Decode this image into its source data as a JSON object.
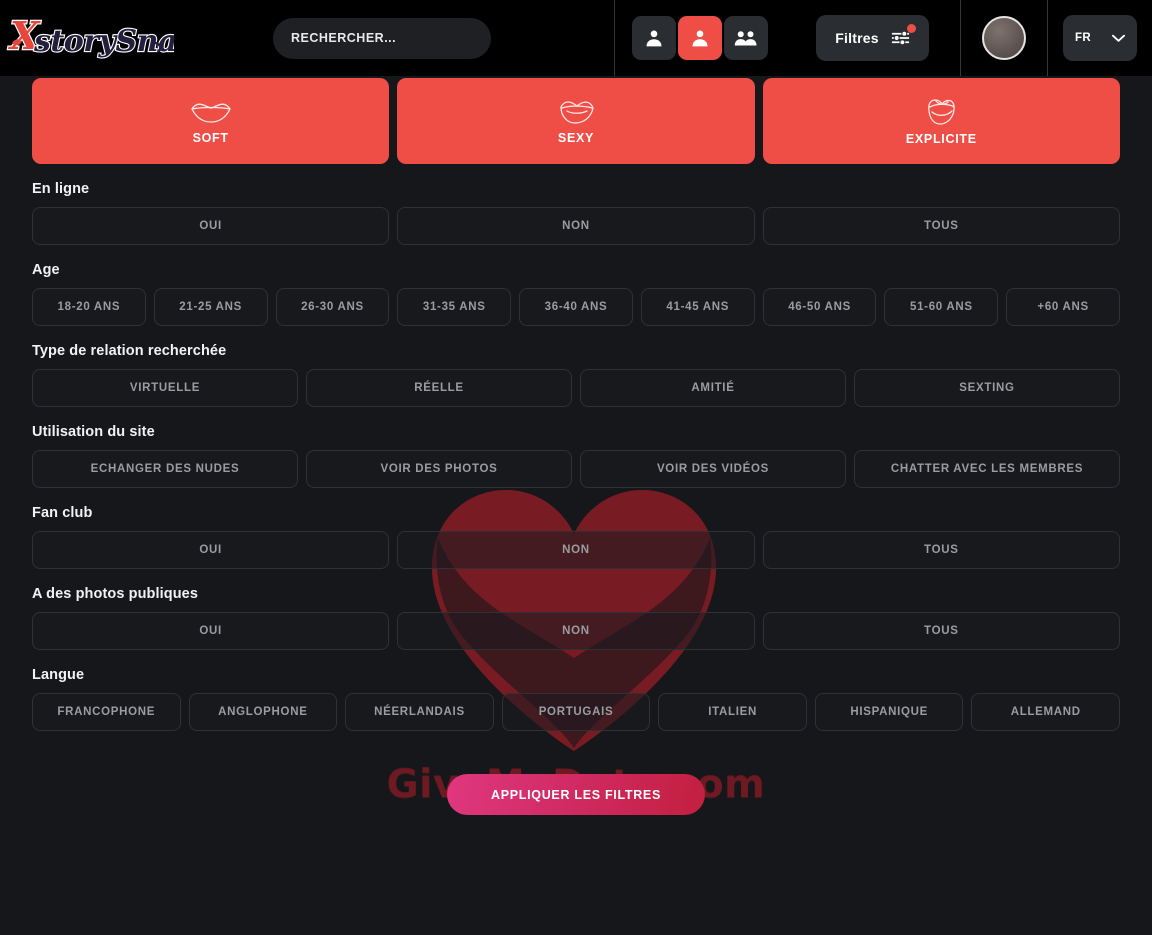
{
  "header": {
    "logo_text": "XstorySnap",
    "search": {
      "placeholder": "RECHERCHER...",
      "value": ""
    },
    "segments": [
      {
        "name": "woman",
        "icon": "single-person-icon",
        "active": false
      },
      {
        "name": "man",
        "icon": "single-person-icon",
        "active": true
      },
      {
        "name": "couple",
        "icon": "two-people-icon",
        "active": false
      }
    ],
    "filters_label": "Filtres",
    "filters_icon": "sliders-icon",
    "filters_has_notification": true,
    "avatar_label": "",
    "language_code": "FR",
    "language_chevron": "chevron-down-icon"
  },
  "categories": [
    {
      "label": "SOFT",
      "icon": "lips-soft-icon"
    },
    {
      "label": "SEXY",
      "icon": "lips-sexy-icon"
    },
    {
      "label": "EXPLICITE",
      "icon": "lips-explicite-icon"
    }
  ],
  "sections": [
    {
      "title": "En ligne",
      "options": [
        "OUI",
        "NON",
        "TOUS"
      ]
    },
    {
      "title": "Age",
      "options": [
        "18-20 ANS",
        "21-25 ANS",
        "26-30 ANS",
        "31-35 ANS",
        "36-40 ANS",
        "41-45 ANS",
        "46-50 ANS",
        "51-60 ANS",
        "+60 ANS"
      ]
    },
    {
      "title": "Type de relation recherchée",
      "options": [
        "VIRTUELLE",
        "RÉELLE",
        "AMITIÉ",
        "SEXTING"
      ]
    },
    {
      "title": "Utilisation du site",
      "options": [
        "ECHANGER DES NUDES",
        "VOIR DES PHOTOS",
        "VOIR DES VIDÉOS",
        "CHATTER AVEC LES MEMBRES"
      ]
    },
    {
      "title": "Fan club",
      "options": [
        "OUI",
        "NON",
        "TOUS"
      ]
    },
    {
      "title": "A des photos publiques",
      "options": [
        "OUI",
        "NON",
        "TOUS"
      ]
    },
    {
      "title": "Langue",
      "options": [
        "FRANCOPHONE",
        "ANGLOPHONE",
        "NÉERLANDAIS",
        "PORTUGAIS",
        "ITALIEN",
        "HISPANIQUE",
        "ALLEMAND"
      ]
    }
  ],
  "apply_button_label": "APPLIQUER LES FILTRES",
  "watermark": {
    "text": "GiveMeDate.com",
    "heart_icon": "heart-watermark-icon"
  },
  "colors": {
    "accent_red": "#ef4e46",
    "page_background": "#15171a",
    "header_background": "#000000",
    "apply_gradient_start": "#e0377f",
    "apply_gradient_end": "#c31f3f",
    "option_text": "#9a9ca1",
    "watermark_red": "#8c1a24"
  }
}
